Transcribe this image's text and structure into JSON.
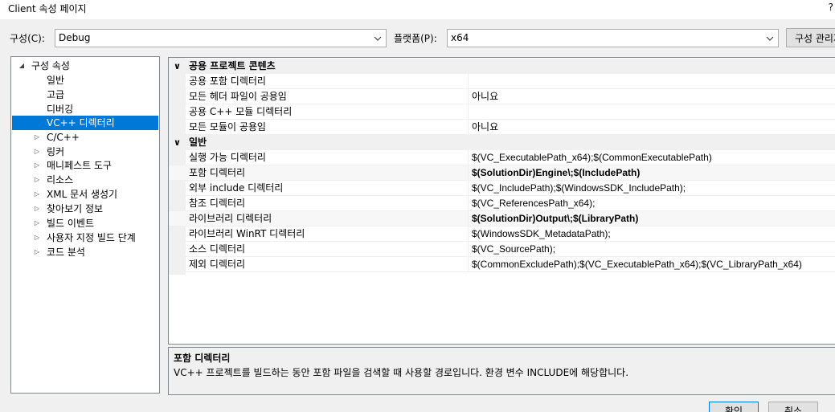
{
  "window": {
    "title": "Client 속성 페이지",
    "help": "?"
  },
  "toolbar": {
    "config_label": "구성(C):",
    "config_value": "Debug",
    "platform_label": "플랫폼(P):",
    "platform_value": "x64",
    "config_manager_label": "구성 관리자..."
  },
  "tree": {
    "items": [
      {
        "label": "구성 속성",
        "expander": "◢"
      },
      {
        "label": "일반"
      },
      {
        "label": "고급"
      },
      {
        "label": "디버깅"
      },
      {
        "label": "VC++ 디렉터리",
        "selected": true
      },
      {
        "label": "C/C++",
        "expander": "▷"
      },
      {
        "label": "링커",
        "expander": "▷"
      },
      {
        "label": "매니페스트 도구",
        "expander": "▷"
      },
      {
        "label": "리소스",
        "expander": "▷"
      },
      {
        "label": "XML 문서 생성기",
        "expander": "▷"
      },
      {
        "label": "찾아보기 정보",
        "expander": "▷"
      },
      {
        "label": "빌드 이벤트",
        "expander": "▷"
      },
      {
        "label": "사용자 지정 빌드 단계",
        "expander": "▷"
      },
      {
        "label": "코드 분석",
        "expander": "▷"
      }
    ]
  },
  "grid": {
    "categories": [
      {
        "name": "공용 프로젝트 콘텐츠",
        "chevron": "∨",
        "props": [
          {
            "name": "공용 포함 디렉터리",
            "value": ""
          },
          {
            "name": "모든 헤더 파일이 공용임",
            "value": "아니요"
          },
          {
            "name": "공용 C++ 모듈 디렉터리",
            "value": ""
          },
          {
            "name": "모든 모듈이 공용임",
            "value": "아니요"
          }
        ]
      },
      {
        "name": "일반",
        "chevron": "∨",
        "props": [
          {
            "name": "실행 가능 디렉터리",
            "value": "$(VC_ExecutablePath_x64);$(CommonExecutablePath)"
          },
          {
            "name": "포함 디렉터리",
            "value": "$(SolutionDir)Engine\\;$(IncludePath)",
            "bold": true
          },
          {
            "name": "외부 include 디렉터리",
            "value": "$(VC_IncludePath);$(WindowsSDK_IncludePath);"
          },
          {
            "name": "참조 디렉터리",
            "value": "$(VC_ReferencesPath_x64);"
          },
          {
            "name": "라이브러리 디렉터리",
            "value": "$(SolutionDir)Output\\;$(LibraryPath)",
            "bold": true
          },
          {
            "name": "라이브러리 WinRT 디렉터리",
            "value": "$(WindowsSDK_MetadataPath);"
          },
          {
            "name": "소스 디렉터리",
            "value": "$(VC_SourcePath);"
          },
          {
            "name": "제외 디렉터리",
            "value": "$(CommonExcludePath);$(VC_ExecutablePath_x64);$(VC_LibraryPath_x64)"
          }
        ]
      }
    ]
  },
  "description": {
    "title": "포함 디렉터리",
    "text": "VC++ 프로젝트를 빌드하는 동안 포함 파일을 검색할 때 사용할 경로입니다.  환경 변수 INCLUDE에 해당합니다."
  },
  "buttons": {
    "ok": "확인",
    "cancel": "취소"
  }
}
